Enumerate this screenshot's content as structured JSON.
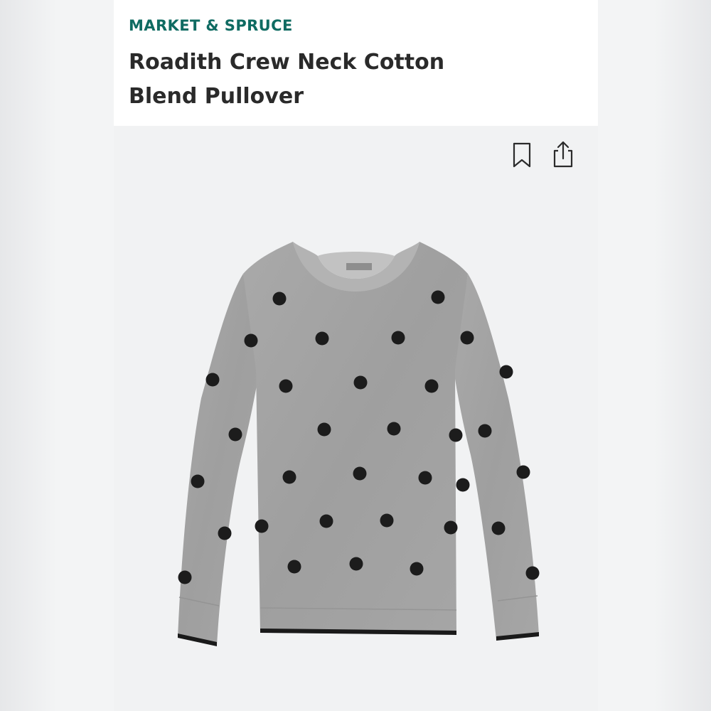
{
  "product": {
    "brand": "MARKET & SPRUCE",
    "title": "Roadith Crew Neck Cotton Blend Pullover"
  },
  "actions": [
    {
      "icon": "bookmark-icon"
    },
    {
      "icon": "share-icon"
    }
  ],
  "image": {
    "subject": "sweater",
    "colors": {
      "body": "#a4a4a4",
      "dots": "#1c1c1c",
      "trim": "#1a1a1a"
    }
  }
}
